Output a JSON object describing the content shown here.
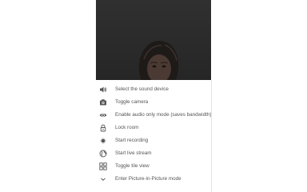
{
  "video": {
    "state": "camera-on"
  },
  "menu": {
    "items": [
      {
        "label": "Select the sound device",
        "icon": "speaker-icon"
      },
      {
        "label": "Toggle camera",
        "icon": "camera-icon"
      },
      {
        "label": "Enable audio only mode (saves bandwidth)",
        "icon": "eye-icon"
      },
      {
        "label": "Lock room",
        "icon": "lock-icon"
      },
      {
        "label": "Start recording",
        "icon": "record-icon"
      },
      {
        "label": "Start live stream",
        "icon": "globe-icon"
      },
      {
        "label": "Toggle tile view",
        "icon": "tile-view-icon"
      },
      {
        "label": "Enter Picture-in-Picture mode",
        "icon": "chevron-down-icon"
      }
    ]
  },
  "colors": {
    "icon": "#555555",
    "text": "#555555",
    "video_background": "#2c2c2c"
  }
}
